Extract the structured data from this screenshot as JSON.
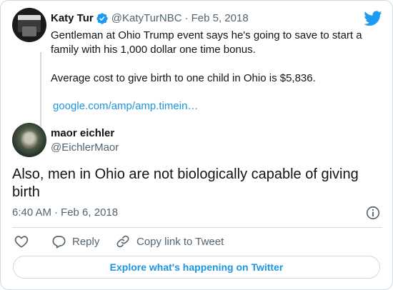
{
  "parent_tweet": {
    "author_name": "Katy Tur",
    "author_handle": "@KatyTurNBC",
    "separator": "·",
    "date": "Feb 5, 2018",
    "text_line1": "Gentleman at Ohio Trump event says he's going to save to start a family with his 1,000 dollar one time bonus.",
    "text_line2": "Average cost to give birth to one child in Ohio is $5,836.",
    "link": "google.com/amp/amp.timein…"
  },
  "tweet": {
    "author_name": "maor eichler",
    "author_handle": "@EichlerMaor",
    "text": "Also, men in Ohio are not biologically capable of giving birth",
    "time": "6:40 AM",
    "separator": "·",
    "date": "Feb 6, 2018"
  },
  "actions": {
    "like_icon": "heart-icon",
    "reply_label": "Reply",
    "copy_link_label": "Copy link to Tweet"
  },
  "explore": {
    "label": "Explore what's happening on Twitter"
  },
  "colors": {
    "twitter_blue": "#1d9bf0",
    "link_blue": "#1b95e0",
    "secondary_text": "#536471",
    "border": "#cfd9de"
  }
}
